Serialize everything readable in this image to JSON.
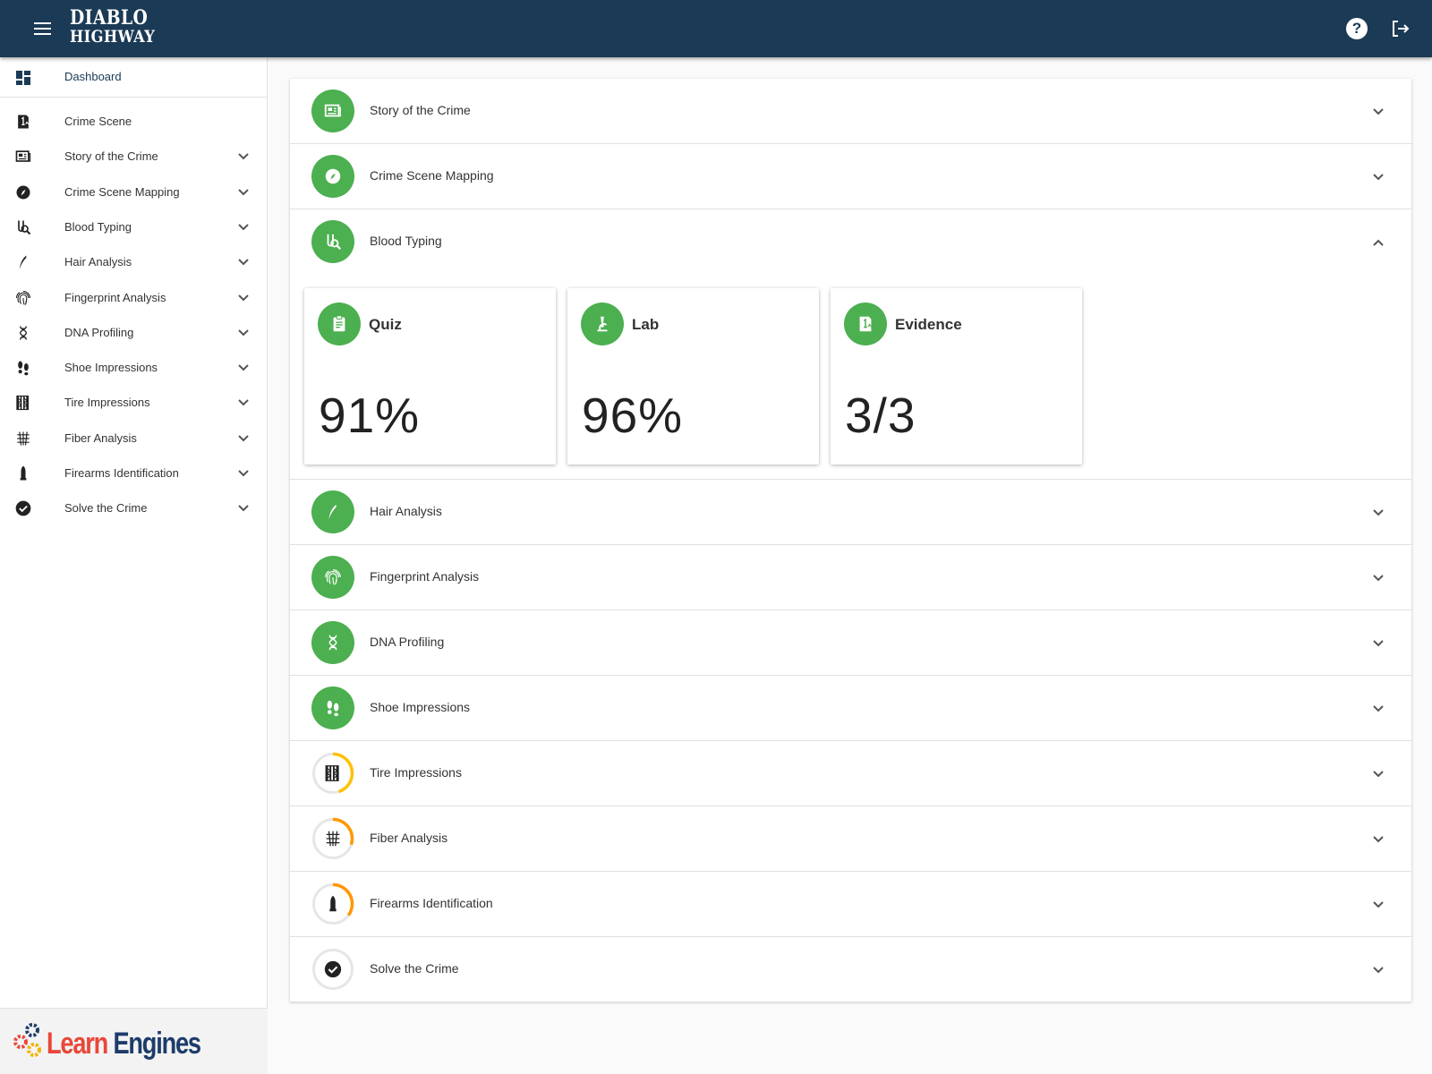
{
  "header": {
    "logo_line1": "DIABLO",
    "logo_line2": "HIGHWAY",
    "help_label": "?"
  },
  "sidebar": {
    "dashboard": {
      "label": "Dashboard",
      "icon": "dashboard-icon"
    },
    "items": [
      {
        "label": "Crime Scene",
        "icon": "evidence-icon",
        "expandable": false
      },
      {
        "label": "Story of the Crime",
        "icon": "newspaper-icon",
        "expandable": true
      },
      {
        "label": "Crime Scene Mapping",
        "icon": "compass-icon",
        "expandable": true
      },
      {
        "label": "Blood Typing",
        "icon": "blood-test-icon",
        "expandable": true
      },
      {
        "label": "Hair Analysis",
        "icon": "hair-icon",
        "expandable": true
      },
      {
        "label": "Fingerprint Analysis",
        "icon": "fingerprint-icon",
        "expandable": true
      },
      {
        "label": "DNA Profiling",
        "icon": "dna-icon",
        "expandable": true
      },
      {
        "label": "Shoe Impressions",
        "icon": "footprints-icon",
        "expandable": true
      },
      {
        "label": "Tire Impressions",
        "icon": "tire-tread-icon",
        "expandable": true
      },
      {
        "label": "Fiber Analysis",
        "icon": "fiber-icon",
        "expandable": true
      },
      {
        "label": "Firearms Identification",
        "icon": "bullet-icon",
        "expandable": true
      },
      {
        "label": "Solve the Crime",
        "icon": "check-circle-icon",
        "expandable": true
      }
    ],
    "footer_brand_part1": "Learn",
    "footer_brand_part2": "Engines"
  },
  "main": {
    "sections": [
      {
        "title": "Story of the Crime",
        "icon": "newspaper-icon",
        "status": "complete",
        "expanded": false
      },
      {
        "title": "Crime Scene Mapping",
        "icon": "compass-icon",
        "status": "complete",
        "expanded": false
      },
      {
        "title": "Blood Typing",
        "icon": "blood-test-icon",
        "status": "complete",
        "expanded": true,
        "cards": [
          {
            "title": "Quiz",
            "value": "91%",
            "icon": "clipboard-icon"
          },
          {
            "title": "Lab",
            "value": "96%",
            "icon": "microscope-icon"
          },
          {
            "title": "Evidence",
            "value": "3/3",
            "icon": "evidence-icon"
          }
        ]
      },
      {
        "title": "Hair Analysis",
        "icon": "hair-icon",
        "status": "complete",
        "expanded": false
      },
      {
        "title": "Fingerprint Analysis",
        "icon": "fingerprint-icon",
        "status": "complete",
        "expanded": false
      },
      {
        "title": "DNA Profiling",
        "icon": "dna-icon",
        "status": "complete",
        "expanded": false
      },
      {
        "title": "Shoe Impressions",
        "icon": "footprints-icon",
        "status": "complete",
        "expanded": false
      },
      {
        "title": "Tire Impressions",
        "icon": "tire-tread-icon",
        "status": "in-progress",
        "progress": 0.45,
        "ring_color": "#ffc107",
        "expanded": false
      },
      {
        "title": "Fiber Analysis",
        "icon": "fiber-icon",
        "status": "in-progress",
        "progress": 0.3,
        "ring_color": "#ff9800",
        "expanded": false
      },
      {
        "title": "Firearms Identification",
        "icon": "bullet-icon",
        "status": "in-progress",
        "progress": 0.35,
        "ring_color": "#ff9800",
        "expanded": false
      },
      {
        "title": "Solve the Crime",
        "icon": "check-circle-icon",
        "status": "not-started",
        "progress": 0,
        "expanded": false
      }
    ]
  },
  "colors": {
    "header_bg": "#1b3a55",
    "complete_green": "#4caf50",
    "brand_red": "#e8483a",
    "brand_blue": "#1d3c6b"
  }
}
